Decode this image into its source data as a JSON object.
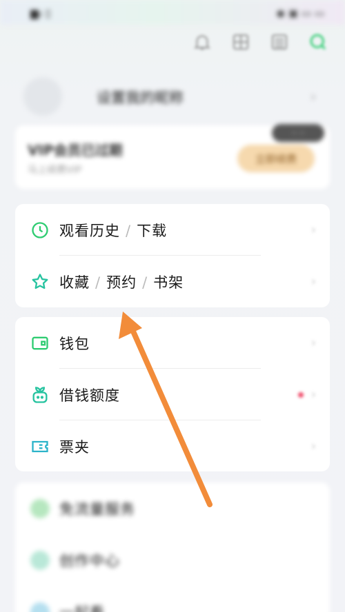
{
  "status_bar": {
    "left_text": "▆ᵢₗ ▯",
    "right_text": "◉ ▣ ▭ ▭"
  },
  "top_icons": [
    "bell-icon",
    "scan-icon",
    "menu-icon",
    "search-icon"
  ],
  "profile": {
    "name": "设置我的昵称",
    "chevron": "›"
  },
  "vip": {
    "title": "VIP会员已过期",
    "subtitle": "马上续费VIP",
    "badge": "·· ··",
    "button": "立即续费"
  },
  "menu_group_1": [
    {
      "icon": "clock-icon",
      "parts": [
        "观看历史",
        "下载"
      ]
    },
    {
      "icon": "star-icon",
      "parts": [
        "收藏",
        "预约",
        "书架"
      ]
    }
  ],
  "menu_group_2": [
    {
      "icon": "wallet-icon",
      "label": "钱包"
    },
    {
      "icon": "sprout-icon",
      "label": "借钱额度",
      "has_dot": true
    },
    {
      "icon": "ticket-icon",
      "label": "票夹"
    }
  ],
  "menu_group_3": [
    {
      "icon": "circle-icon",
      "label": "免流量服务"
    },
    {
      "icon": "circle-icon",
      "label": "创作中心"
    },
    {
      "icon": "circle-icon",
      "label": "一起看"
    }
  ],
  "colors": {
    "accent_green": "#2ecc71",
    "arrow_orange": "#f28c3a",
    "vip_button_bg": "#f6d9ae"
  },
  "chevron": "›",
  "separator": "/"
}
